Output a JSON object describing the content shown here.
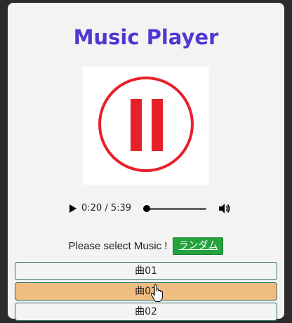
{
  "app": {
    "title": "Music Player"
  },
  "cover": {
    "icon": "pause-circle-icon",
    "color": "#e8202a"
  },
  "player": {
    "time_display": "0:20 / 5:39",
    "progress": 0.059,
    "play_icon": "play-icon",
    "volume_icon": "volume-icon"
  },
  "select": {
    "prompt": "Please select Music !",
    "random_label": "ランダム"
  },
  "tracks": [
    {
      "label": "曲01"
    },
    {
      "label": "曲01"
    },
    {
      "label": "曲02"
    }
  ],
  "colors": {
    "title": "#4f38d1",
    "random_button": "#23a23e",
    "active_track": "#efbd7f",
    "track_border": "#2f6f66"
  }
}
